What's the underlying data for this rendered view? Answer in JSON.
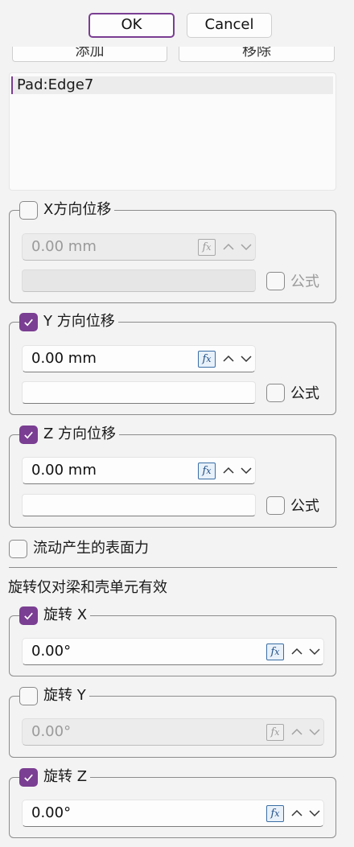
{
  "header": {
    "ok_label": "OK",
    "cancel_label": "Cancel"
  },
  "references": {
    "add_label": "添加",
    "remove_label": "移除",
    "items": [
      "Pad:Edge7"
    ]
  },
  "displacement": {
    "x": {
      "label": "X方向位移",
      "checked": false,
      "value": "0.00 mm",
      "formula_label": "公式",
      "formula_checked": false,
      "enabled": false
    },
    "y": {
      "label": "Y 方向位移",
      "checked": true,
      "value": "0.00 mm",
      "formula_label": "公式",
      "formula_checked": false,
      "enabled": true
    },
    "z": {
      "label": "Z 方向位移",
      "checked": true,
      "value": "0.00 mm",
      "formula_label": "公式",
      "formula_checked": false,
      "enabled": true
    }
  },
  "flow_force": {
    "label": "流动产生的表面力",
    "checked": false
  },
  "rotation_note": "旋转仅对梁和壳单元有效",
  "rotation": {
    "x": {
      "label": "旋转 X",
      "checked": true,
      "value": "0.00°",
      "enabled": true
    },
    "y": {
      "label": "旋转 Y",
      "checked": false,
      "value": "0.00°",
      "enabled": false
    },
    "z": {
      "label": "旋转 Z",
      "checked": true,
      "value": "0.00°",
      "enabled": true
    }
  },
  "icons": {
    "fx": "fx",
    "check": "checkmark-icon",
    "up": "chevron-up-icon",
    "down": "chevron-down-icon"
  },
  "colors": {
    "accent": "#7a3e92",
    "fx_blue": "#1f4e85"
  }
}
